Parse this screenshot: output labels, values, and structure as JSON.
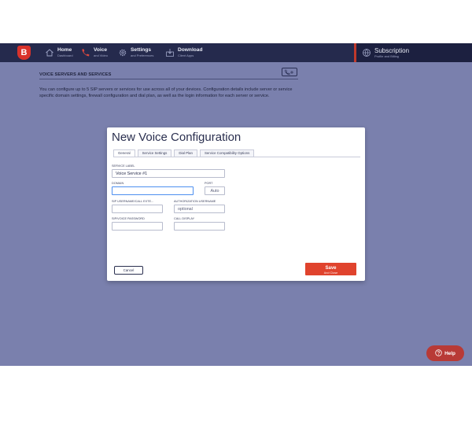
{
  "header": {
    "logo_letter": "B",
    "nav": [
      {
        "title": "Home",
        "sub": "Dashboard",
        "icon": "home-icon"
      },
      {
        "title": "Voice",
        "sub": "and Video",
        "icon": "phone-icon"
      },
      {
        "title": "Settings",
        "sub": "and Preferences",
        "icon": "gear-icon"
      },
      {
        "title": "Download",
        "sub": "Client Apps",
        "icon": "download-icon"
      }
    ],
    "subscription": {
      "title": "Subscription",
      "sub": "Profile and Billing",
      "icon": "globe-icon"
    }
  },
  "section": {
    "title": "VOICE SERVERS AND SERVICES",
    "description": "You can configure up to 5 SIP servers or services for use across all of your devices. Configuration details include server or service specific domain settings, firewall configuration and dial plan, as well as the login information for each server or service."
  },
  "modal": {
    "title": "New Voice Configuration",
    "tabs": [
      "General",
      "Service Settings",
      "Dial Plan",
      "Service Compatibility Options"
    ],
    "fields": {
      "service_label": {
        "label": "SERVICE LABEL",
        "value": "Voice Service #1"
      },
      "domain": {
        "label": "DOMAIN",
        "value": ""
      },
      "port": {
        "label": "PORT",
        "placeholder": "Auto"
      },
      "sip_username": {
        "label": "SIP USERNAME/CALL EXTE...",
        "value": ""
      },
      "auth_username": {
        "label": "AUTHORIZATION USERNAME",
        "placeholder": "optional"
      },
      "sip_password": {
        "label": "SIP/VOICE PASSWORD",
        "value": ""
      },
      "call_display": {
        "label": "CALL DISPLAY",
        "value": ""
      }
    },
    "cancel_label": "Cancel",
    "save_label": "Save",
    "save_sub_label": "And Close"
  },
  "help": {
    "label": "Help",
    "icon": "help-circle-icon"
  },
  "colors": {
    "topbar": "#252a4d",
    "page_bg": "#7a80ad",
    "accent_red": "#d9322b",
    "save_button": "#e0432d",
    "focus_blue": "#4d8ff0"
  }
}
